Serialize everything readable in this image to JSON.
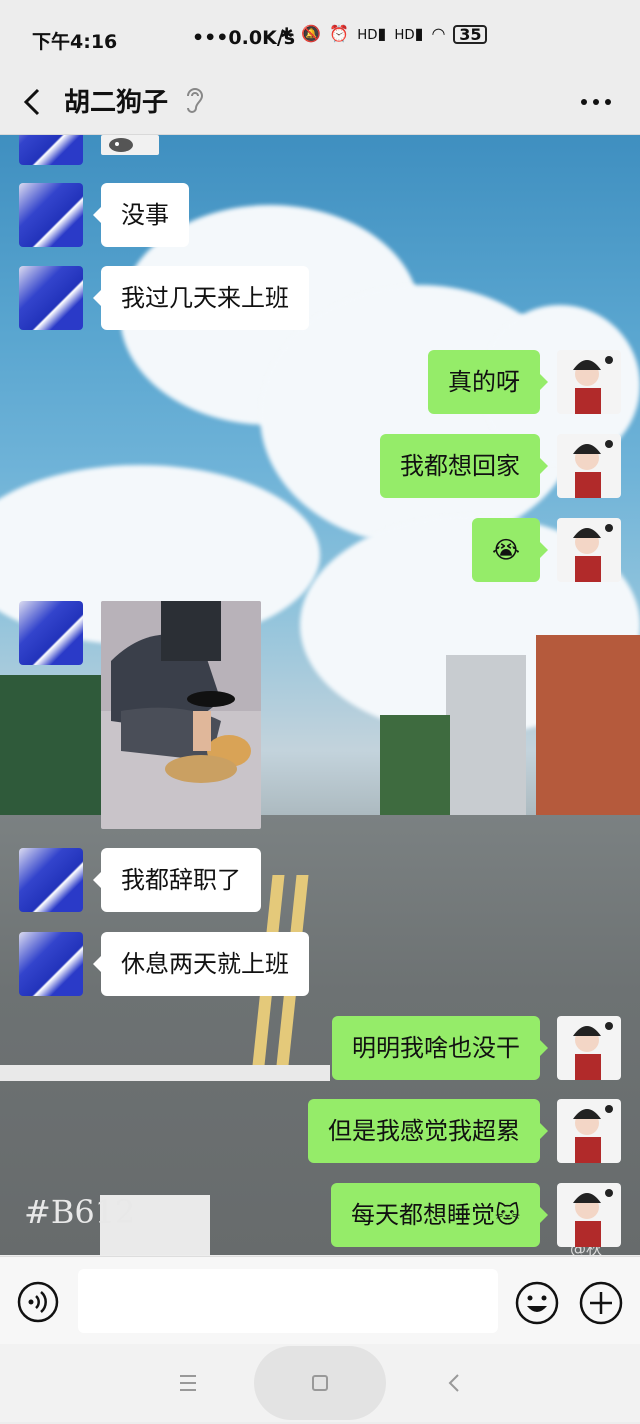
{
  "status_bar": {
    "time": "下午4:16",
    "network_speed": "•••0.0K/s",
    "signal_1_label": "HD",
    "signal_2_label": "HD",
    "battery": "35"
  },
  "header": {
    "title": "胡二狗子"
  },
  "background_watermark": "#B612",
  "weibo_mark": "@秋",
  "messages": [
    {
      "side": "left",
      "type": "sticker"
    },
    {
      "side": "left",
      "type": "text",
      "text": "没事"
    },
    {
      "side": "left",
      "type": "text",
      "text": "我过几天来上班"
    },
    {
      "side": "right",
      "type": "text",
      "text": "真的呀"
    },
    {
      "side": "right",
      "type": "text",
      "text": "我都想回家"
    },
    {
      "side": "right",
      "type": "emoji",
      "text": "😭"
    },
    {
      "side": "left",
      "type": "image"
    },
    {
      "side": "left",
      "type": "text",
      "text": "我都辞职了"
    },
    {
      "side": "left",
      "type": "text",
      "text": "休息两天就上班"
    },
    {
      "side": "right",
      "type": "text",
      "text": "明明我啥也没干"
    },
    {
      "side": "right",
      "type": "text",
      "text": "但是我感觉我超累"
    },
    {
      "side": "right",
      "type": "text",
      "text": "每天都想睡觉🐱"
    }
  ],
  "input_bar": {
    "placeholder": ""
  },
  "colors": {
    "my_bubble": "#95ec69",
    "friend_bubble": "#ffffff",
    "chrome_bg": "#ededed"
  }
}
